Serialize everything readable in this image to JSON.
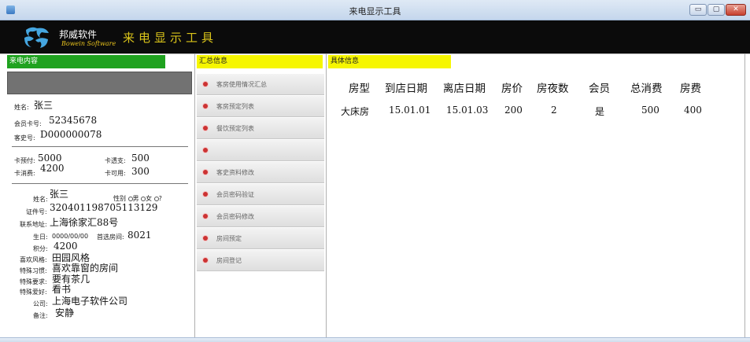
{
  "window": {
    "title": "来电显示工具",
    "minimize_glyph": "▭",
    "maximize_glyph": "▢",
    "close_glyph": "✕"
  },
  "brand": {
    "name": "邦威软件",
    "subtitle": "Bowein Software",
    "app_name": "来电显示工具",
    "logo_color": "#45a6e0"
  },
  "sections": {
    "caller": "来电内容",
    "summary": "汇总信息",
    "detail": "具体信息"
  },
  "colors": {
    "caller_tag": "#1fa21f",
    "summary_tag": "#f6f600",
    "detail_tag": "#f6f600",
    "bullet": "#cc3333"
  },
  "caller": {
    "name_label": "姓名:",
    "name": "张三",
    "card_label": "会员卡号:",
    "card_no": "52345678",
    "guest_label": "客史号:",
    "guest_no": "D000000078"
  },
  "account": {
    "prepaid_label": "卡预付:",
    "prepaid": "5000",
    "overdraft_label": "卡透支:",
    "overdraft": "500",
    "consumed_label": "卡消费:",
    "consumed": "4200",
    "available_label": "卡可用:",
    "available": "300"
  },
  "profile": {
    "name_label": "姓名:",
    "name": "张三",
    "gender_label": "性别",
    "gender_male": "男",
    "gender_female": "女",
    "gender_unknown": "?",
    "id_label": "证件号:",
    "id": "320401198705113129",
    "address_label": "联系地址:",
    "address": "上海徐家汇88号",
    "birthday_label": "生日:",
    "birthday": "0000/00/00",
    "room_pref_label": "首选房间:",
    "room_pref": "8021",
    "points_label": "积分:",
    "points": "4200",
    "style_label": "喜欢风格:",
    "style": "田园风格",
    "habit_label": "特殊习惯:",
    "habit": "喜欢靠窗的房间",
    "request_label": "特殊要求:",
    "request": "要有茶几",
    "hobby_label": "特殊爱好:",
    "hobby": "看书",
    "company_label": "公司:",
    "company": "上海电子软件公司",
    "remark_label": "备注:",
    "remark": "安静"
  },
  "menu": [
    {
      "label": "客房使用情况汇总"
    },
    {
      "label": "客房预定列表"
    },
    {
      "label": "餐饮预定列表"
    },
    {
      "label": ""
    },
    {
      "label": "客史资料修改"
    },
    {
      "label": "会员密码验证"
    },
    {
      "label": "会员密码修改"
    },
    {
      "label": "房间预定"
    },
    {
      "label": "房间登记"
    }
  ],
  "detail_table": {
    "headers": [
      "房型",
      "到店日期",
      "离店日期",
      "房价",
      "房夜数",
      "会员",
      "总消费",
      "房费"
    ],
    "rows": [
      [
        "大床房",
        "15.01.01",
        "15.01.03",
        "200",
        "2",
        "是",
        "500",
        "400"
      ]
    ]
  }
}
